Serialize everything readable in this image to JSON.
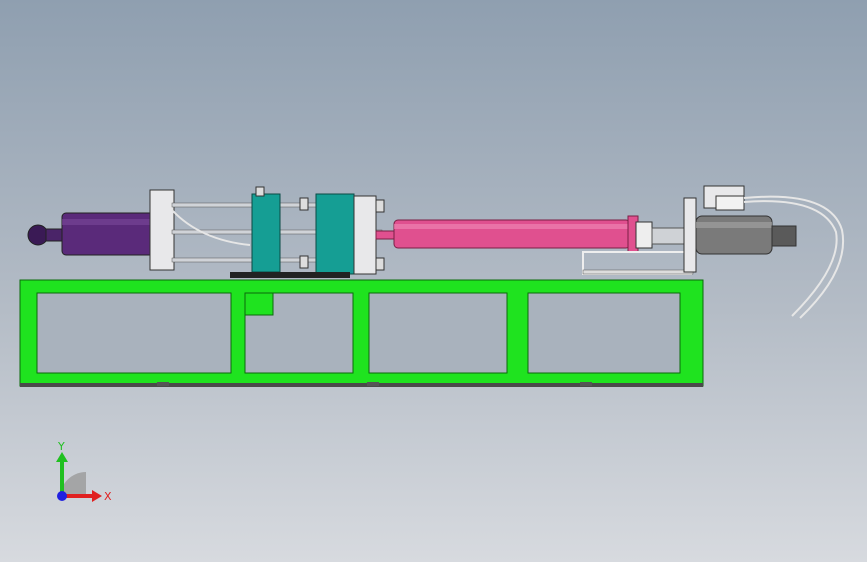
{
  "scene": {
    "background_top": "#8f9fb0",
    "background_bottom": "#d7dadf",
    "components": {
      "frame_color": "#1fe31f",
      "injection_barrel_color": "#e0508f",
      "clamp_cylinder_color": "#5a2a7a",
      "mold_color": "#159e94",
      "motor_color": "#7a7a7a"
    }
  },
  "triad": {
    "x_label": "X",
    "y_label": "Y",
    "x_color": "#e02020",
    "y_color": "#20c020",
    "origin_color": "#2020e0"
  }
}
